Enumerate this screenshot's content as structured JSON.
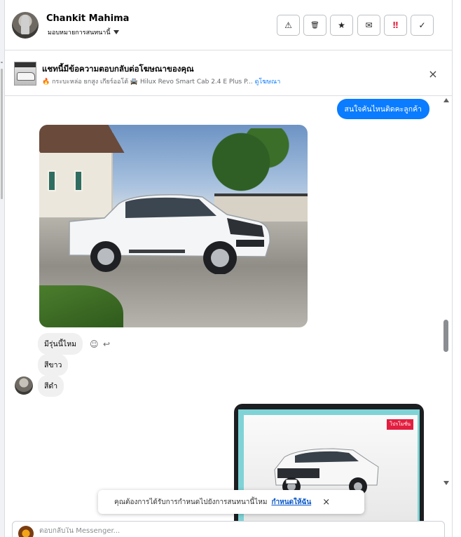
{
  "header": {
    "contact_name": "Chankit Mahima",
    "assign_label": "มอบหมายการสนทนานี้",
    "actions": [
      {
        "name": "warning",
        "glyph": "⚠"
      },
      {
        "name": "trash",
        "glyph": "🗑"
      },
      {
        "name": "star",
        "glyph": "★"
      },
      {
        "name": "mail",
        "glyph": "✉"
      },
      {
        "name": "spam",
        "glyph": "‼"
      },
      {
        "name": "done",
        "glyph": "✓"
      }
    ]
  },
  "ad": {
    "title": "แชทนี้มีข้อความตอบกลับต่อโฆษณาของคุณ",
    "desc": "กระบะหล่อ ยกสูง เกียร์ออโต้ 🚔 Hilux Revo Smart Cab 2.4 E Plus P...",
    "view_link": "ดูโฆษณา",
    "close_glyph": "×"
  },
  "messages": {
    "outgoing_1": "สนใจคันไหนติดคะลูกค้า",
    "incoming": [
      "มีรุ่นนี้ไหม",
      "สีขาว",
      "สีดำ"
    ],
    "shared_tag": "โปรโมชั่น",
    "react_emoji": "☺",
    "react_reply": "↩"
  },
  "toast": {
    "text": "คุณต้องการได้รับการกำหนดไปยังการสนทนานี้ไหม",
    "action": "กำหนดให้ฉัน",
    "close_glyph": "×"
  },
  "composer": {
    "placeholder": "ตอบกลับใน Messenger..."
  },
  "colors": {
    "accent": "#0a7cff",
    "bubble_in": "#f0f0f0"
  }
}
